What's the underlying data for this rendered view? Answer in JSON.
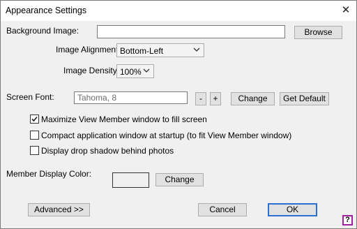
{
  "window": {
    "title": "Appearance Settings",
    "close_glyph": "✕"
  },
  "background_image": {
    "label": "Background Image:",
    "value": "",
    "browse_label": "Browse"
  },
  "image_alignment": {
    "label": "Image Alignment:",
    "value": "Bottom-Left"
  },
  "image_density": {
    "label": "Image Density:",
    "value": "100%"
  },
  "screen_font": {
    "label": "Screen Font:",
    "value": "Tahoma, 8",
    "decrease_label": "-",
    "increase_label": "+",
    "change_label": "Change",
    "default_label": "Get Default"
  },
  "options": [
    {
      "label": "Maximize View Member window to fill screen",
      "checked": true
    },
    {
      "label": "Compact application window at startup (to fit View Member window)",
      "checked": false
    },
    {
      "label": "Display drop shadow behind photos",
      "checked": false
    }
  ],
  "member_color": {
    "label": "Member Display Color:",
    "color": "#f0f0f0",
    "change_label": "Change"
  },
  "footer": {
    "advanced_label": "Advanced >>",
    "cancel_label": "Cancel",
    "ok_label": "OK",
    "help_label": "?"
  },
  "colors": {
    "accent": "#2a6fd1",
    "help_border": "#a020a0"
  }
}
